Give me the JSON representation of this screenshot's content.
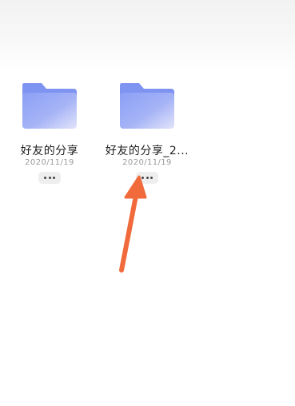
{
  "files": [
    {
      "name": "好友的分享",
      "date": "2020/11/19",
      "icon": "folder-icon",
      "more_icon": "more-dots-icon"
    },
    {
      "name": "好友的分享_2...",
      "date": "2020/11/19",
      "icon": "folder-icon",
      "more_icon": "more-dots-icon"
    }
  ],
  "annotation": {
    "icon": "arrow-icon",
    "color": "#f06a3c"
  },
  "colors": {
    "folder_back": "#7f95f2",
    "folder_front_start": "#8fa2f5",
    "folder_front_end": "#d8dcf8"
  }
}
